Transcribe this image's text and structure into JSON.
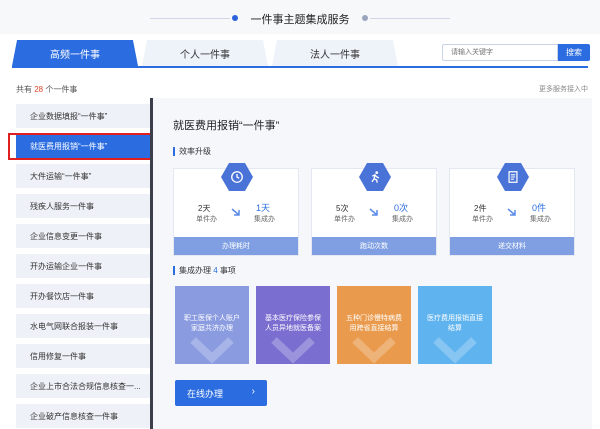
{
  "header": {
    "title": "一件事主题集成服务"
  },
  "tabs": [
    {
      "label": "高频一件事"
    },
    {
      "label": "个人一件事"
    },
    {
      "label": "法人一件事"
    }
  ],
  "search": {
    "placeholder": "请输入关键字",
    "button_label": "搜索"
  },
  "count": {
    "prefix": "共有",
    "number": "28",
    "suffix": "个一件事"
  },
  "more_link": "更多服务接入中",
  "sidebar": {
    "items": [
      {
        "label": "企业数据填报“一件事”"
      },
      {
        "label": "就医费用报销“一件事”"
      },
      {
        "label": "大件运输“一件事”"
      },
      {
        "label": "残疾人服务一件事"
      },
      {
        "label": "企业信息变更一件事"
      },
      {
        "label": "开办运输企业一件事"
      },
      {
        "label": "开办餐饮店一件事"
      },
      {
        "label": "水电气网联合报装一件事"
      },
      {
        "label": "信用修复一件事"
      },
      {
        "label": "企业上市合法合规信息核查一..."
      },
      {
        "label": "企业破产信息核查一件事"
      }
    ],
    "active_index": 1
  },
  "panel": {
    "title": "就医费用报销“一件事”",
    "efficiency_title": "效率升级",
    "cards": [
      {
        "icon": "clock-icon",
        "before_value": "2天",
        "before_label": "单件办",
        "after_value": "1天",
        "after_label": "集成办",
        "footer": "办理耗时"
      },
      {
        "icon": "running-person-icon",
        "before_value": "5次",
        "before_label": "单件办",
        "after_value": "0次",
        "after_label": "集成办",
        "footer": "跑动次数"
      },
      {
        "icon": "document-icon",
        "before_value": "2件",
        "before_label": "单件办",
        "after_value": "0件",
        "after_label": "集成办",
        "footer": "递交材料"
      }
    ],
    "integrated": {
      "prefix": "集成办理",
      "number": "4",
      "suffix": "事项"
    },
    "tiles": [
      {
        "text": "职工医保个人账户家庭共济办理",
        "color": "#8a9be0"
      },
      {
        "text": "基本医疗保险参保人员异地就医备案",
        "color": "#7a6fd0"
      },
      {
        "text": "五种门诊慢特病费用跨省直接结算",
        "color": "#e99a4c"
      },
      {
        "text": "医疗费用报销直接结算",
        "color": "#5fb3ee"
      }
    ],
    "online_button": "在线办理",
    "online_arrow": "›"
  },
  "colors": {
    "primary": "#2b6de0",
    "highlight_border": "#e02020",
    "count_number": "#e0452c"
  }
}
